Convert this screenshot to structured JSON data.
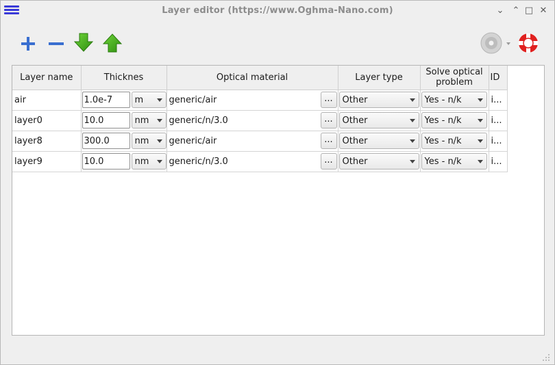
{
  "window": {
    "title": "Layer editor (https://www.Oghma-Nano.com)",
    "buttons": {
      "collapse": "⌄",
      "expand": "⌃",
      "maximize": "□",
      "close": "✕"
    }
  },
  "toolbar": {
    "add_icon": "plus-icon",
    "remove_icon": "minus-icon",
    "move_down_icon": "arrow-down-icon",
    "move_up_icon": "arrow-up-icon",
    "disc_icon": "disc-icon",
    "help_icon": "lifebuoy-icon",
    "colors": {
      "blue": "#3a6fd0",
      "green": "#46b51c",
      "red": "#e0201f"
    }
  },
  "table": {
    "headers": {
      "name": "Layer name",
      "thickness": "Thicknes",
      "material": "Optical material",
      "type": "Layer type",
      "solve_line1": "Solve optical",
      "solve_line2": "problem",
      "id": "ID"
    },
    "rows": [
      {
        "name": "air",
        "thickness": "1.0e-7",
        "unit": "m",
        "material": "generic/air",
        "browse": "...",
        "type": "Other",
        "solve": "Yes - n/k",
        "id": "i..."
      },
      {
        "name": "layer0",
        "thickness": "10.0",
        "unit": "nm",
        "material": "generic/n/3.0",
        "browse": "...",
        "type": "Other",
        "solve": "Yes - n/k",
        "id": "i..."
      },
      {
        "name": "layer8",
        "thickness": "300.0",
        "unit": "nm",
        "material": "generic/air",
        "browse": "...",
        "type": "Other",
        "solve": "Yes - n/k",
        "id": "i..."
      },
      {
        "name": "layer9",
        "thickness": "10.0",
        "unit": "nm",
        "material": "generic/n/3.0",
        "browse": "...",
        "type": "Other",
        "solve": "Yes - n/k",
        "id": "i..."
      }
    ]
  }
}
